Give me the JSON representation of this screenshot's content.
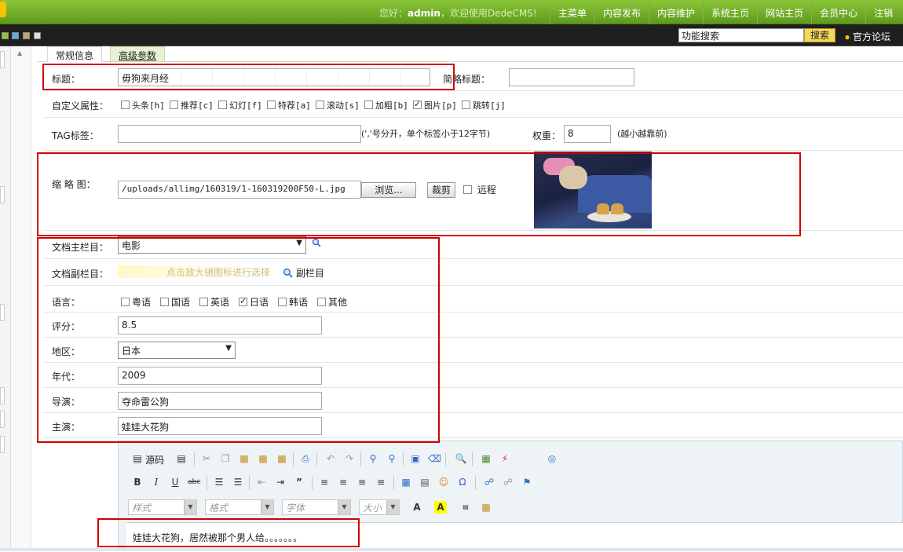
{
  "header": {
    "welcome_prefix": "您好：",
    "username": "admin",
    "welcome_suffix": "，欢迎使用DedeCMS!",
    "nav": [
      "主菜单",
      "内容发布",
      "内容维护",
      "系统主页",
      "网站主页",
      "会员中心",
      "注销"
    ]
  },
  "toolbar2": {
    "search_value": "功能搜索",
    "search_button": "搜索",
    "forum_link": "官方论坛"
  },
  "tabs": [
    "常规信息",
    "高级参数"
  ],
  "form": {
    "title_label": "标题：",
    "title_value": "毋狗来月经",
    "short_title_label": "简略标题：",
    "short_title_value": "",
    "attr_label": "自定义属性：",
    "attrs": [
      {
        "label": "头条[h]",
        "checked": false
      },
      {
        "label": "推荐[c]",
        "checked": false
      },
      {
        "label": "幻灯[f]",
        "checked": false
      },
      {
        "label": "特荐[a]",
        "checked": false
      },
      {
        "label": "滚动[s]",
        "checked": false
      },
      {
        "label": "加粗[b]",
        "checked": false
      },
      {
        "label": "图片[p]",
        "checked": true
      },
      {
        "label": "跳转[j]",
        "checked": false
      }
    ],
    "tag_label": "TAG标签：",
    "tag_value": "",
    "tag_hint": "(','号分开，单个标签小于12字节)",
    "weight_label": "权重：",
    "weight_value": "8",
    "weight_hint": "(越小越靠前)",
    "thumb_label": "缩 略 图：",
    "thumb_path": "/uploads/allimg/160319/1-160319200F50-L.jpg",
    "browse_button": "浏览...",
    "crop_button": "裁剪",
    "remote_label": "远程",
    "main_column_label": "文档主栏目：",
    "main_column_value": "电影",
    "sub_column_label": "文档副栏目：",
    "sub_column_placeholder": "点击放大镜图标进行选择",
    "sub_column_button": "副栏目",
    "language_label": "语言：",
    "languages": [
      {
        "label": "粤语",
        "checked": false
      },
      {
        "label": "国语",
        "checked": false
      },
      {
        "label": "英语",
        "checked": false
      },
      {
        "label": "日语",
        "checked": true
      },
      {
        "label": "韩语",
        "checked": false
      },
      {
        "label": "其他",
        "checked": false
      }
    ],
    "score_label": "评分：",
    "score_value": "8.5",
    "region_label": "地区：",
    "region_value": "日本",
    "year_label": "年代：",
    "year_value": "2009",
    "director_label": "导演：",
    "director_value": "夺命雷公狗",
    "actor_label": "主演：",
    "actor_value": "娃娃大花狗"
  },
  "editor": {
    "source_label": "源码",
    "style_placeholder": "样式",
    "format_placeholder": "格式",
    "font_placeholder": "字体",
    "size_placeholder": "大小",
    "content": "娃娃大花狗，居然被那个男人给。。。。。。。"
  }
}
